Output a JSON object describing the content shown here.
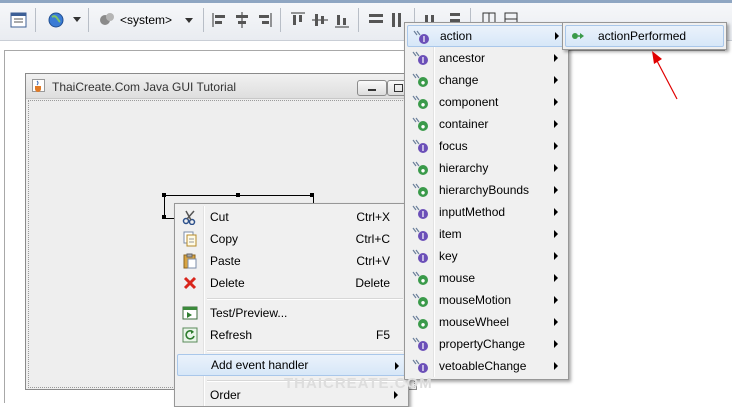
{
  "toolbar": {
    "combo_value": "<system>",
    "icons": [
      "properties-icon",
      "globe-icon",
      "look-and-feel-icon",
      "align-left-icon",
      "align-center-icon",
      "align-right-icon",
      "align-top-icon",
      "align-middle-icon",
      "align-bottom-icon",
      "same-width-icon",
      "same-height-icon",
      "distribute-h-icon",
      "distribute-v-icon",
      "grid-icon",
      "snap-icon"
    ]
  },
  "frame": {
    "title": "ThaiCreate.Com Java GUI Tutorial"
  },
  "context_menu": {
    "items": [
      {
        "label": "Cut",
        "shortcut": "Ctrl+X",
        "icon": "scissors-icon"
      },
      {
        "label": "Copy",
        "shortcut": "Ctrl+C",
        "icon": "copy-icon"
      },
      {
        "label": "Paste",
        "shortcut": "Ctrl+V",
        "icon": "paste-icon"
      },
      {
        "label": "Delete",
        "shortcut": "Delete",
        "icon": "delete-icon"
      },
      {
        "label": "Test/Preview...",
        "shortcut": "",
        "icon": "preview-icon"
      },
      {
        "label": "Refresh",
        "shortcut": "F5",
        "icon": "refresh-icon"
      },
      {
        "label": "Add event handler",
        "shortcut": "",
        "icon": ""
      },
      {
        "label": "Order",
        "shortcut": "",
        "icon": ""
      }
    ]
  },
  "event_menu": {
    "items": [
      {
        "label": "action",
        "badge": "I"
      },
      {
        "label": "ancestor",
        "badge": "I"
      },
      {
        "label": "change",
        "badge": "C"
      },
      {
        "label": "component",
        "badge": "C"
      },
      {
        "label": "container",
        "badge": "C"
      },
      {
        "label": "focus",
        "badge": "I"
      },
      {
        "label": "hierarchy",
        "badge": "C"
      },
      {
        "label": "hierarchyBounds",
        "badge": "C"
      },
      {
        "label": "inputMethod",
        "badge": "I"
      },
      {
        "label": "item",
        "badge": "I"
      },
      {
        "label": "key",
        "badge": "I"
      },
      {
        "label": "mouse",
        "badge": "C"
      },
      {
        "label": "mouseMotion",
        "badge": "C"
      },
      {
        "label": "mouseWheel",
        "badge": "C"
      },
      {
        "label": "propertyChange",
        "badge": "I"
      },
      {
        "label": "vetoableChange",
        "badge": "I"
      }
    ]
  },
  "action_menu": {
    "item": "actionPerformed"
  },
  "watermark": "THAICREATE.COM",
  "colors": {
    "highlight_bg": "#d7e7f8",
    "highlight_border": "#a9c7ea",
    "menu_bg": "#f0f0f0",
    "arrow": "#e00000",
    "badge_interface": "#6b4fb8",
    "badge_class": "#3a9a4a"
  }
}
